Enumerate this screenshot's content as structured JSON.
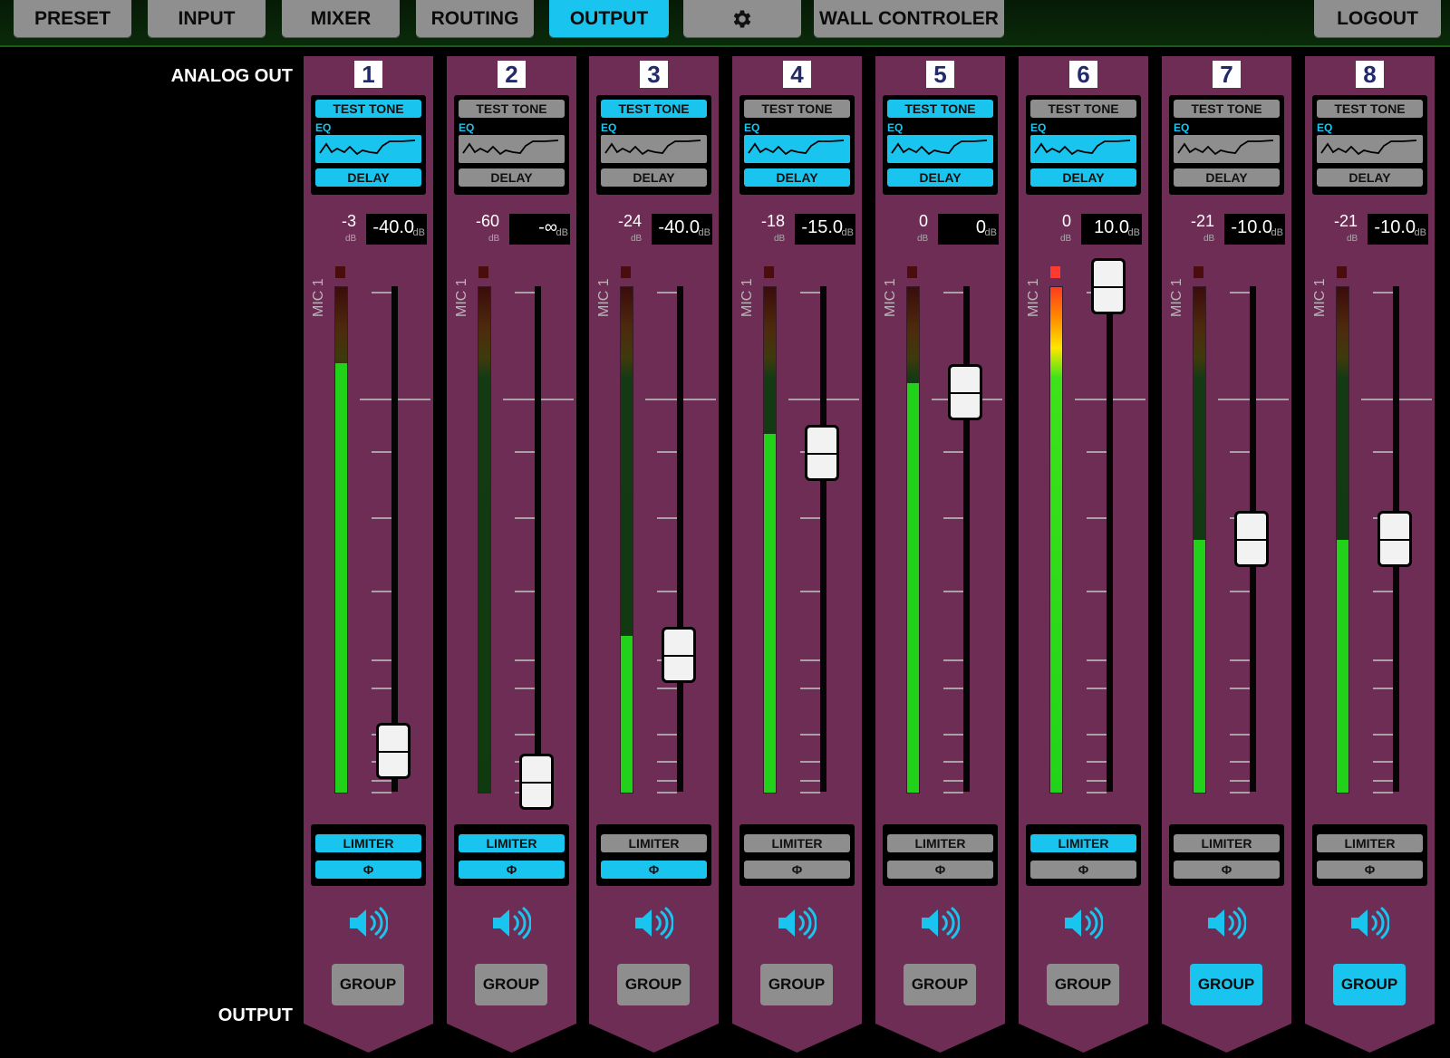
{
  "nav": {
    "tabs": [
      {
        "label": "PRESET",
        "active": false
      },
      {
        "label": "INPUT",
        "active": false
      },
      {
        "label": "MIXER",
        "active": false
      },
      {
        "label": "ROUTING",
        "active": false
      },
      {
        "label": "OUTPUT",
        "active": true
      },
      {
        "icon": "gear-icon",
        "active": false
      },
      {
        "label": "WALL CONTROLER",
        "active": false
      }
    ],
    "logout_label": "LOGOUT"
  },
  "section_labels": {
    "top": "ANALOG OUT",
    "bottom": "OUTPUT"
  },
  "colors": {
    "accent": "#19c4ee",
    "strip": "#6e2d54",
    "meter_green": "#22d21a",
    "clip_red": "#ff3b30"
  },
  "strip_labels": {
    "test_tone": "TEST TONE",
    "eq": "EQ",
    "delay": "DELAY",
    "limiter": "LIMITER",
    "phase": "Φ",
    "group": "GROUP",
    "input_source": "MIC 1",
    "db_unit": "dB",
    "speaker_icon": "speaker-icon"
  },
  "channels": [
    {
      "number": "1",
      "level": "-3",
      "gain": "-40.0",
      "test_tone": true,
      "eq": true,
      "delay": true,
      "limiter": true,
      "phase": true,
      "group": false,
      "meter": 0.85,
      "fader": 0.08,
      "clip": false
    },
    {
      "number": "2",
      "level": "-60",
      "gain": "-∞",
      "test_tone": false,
      "eq": false,
      "delay": false,
      "limiter": true,
      "phase": true,
      "group": false,
      "meter": 0.0,
      "fader": 0.02,
      "clip": false
    },
    {
      "number": "3",
      "level": "-24",
      "gain": "-40.0",
      "test_tone": true,
      "eq": false,
      "delay": false,
      "limiter": false,
      "phase": true,
      "group": false,
      "meter": 0.31,
      "fader": 0.27,
      "clip": false
    },
    {
      "number": "4",
      "level": "-18",
      "gain": "-15.0",
      "test_tone": false,
      "eq": true,
      "delay": true,
      "limiter": false,
      "phase": false,
      "group": false,
      "meter": 0.71,
      "fader": 0.67,
      "clip": false
    },
    {
      "number": "5",
      "level": "0",
      "gain": "0",
      "test_tone": true,
      "eq": true,
      "delay": true,
      "limiter": false,
      "phase": false,
      "group": false,
      "meter": 0.81,
      "fader": 0.79,
      "clip": false
    },
    {
      "number": "6",
      "level": "0",
      "gain": "10.0",
      "test_tone": false,
      "eq": true,
      "delay": true,
      "limiter": true,
      "phase": false,
      "group": false,
      "meter": 1.0,
      "fader": 1.0,
      "clip": true
    },
    {
      "number": "7",
      "level": "-21",
      "gain": "-10.0",
      "test_tone": false,
      "eq": false,
      "delay": false,
      "limiter": false,
      "phase": false,
      "group": true,
      "meter": 0.5,
      "fader": 0.5,
      "clip": false
    },
    {
      "number": "8",
      "level": "-21",
      "gain": "-10.0",
      "test_tone": false,
      "eq": false,
      "delay": false,
      "limiter": false,
      "phase": false,
      "group": true,
      "meter": 0.5,
      "fader": 0.5,
      "clip": false
    }
  ]
}
